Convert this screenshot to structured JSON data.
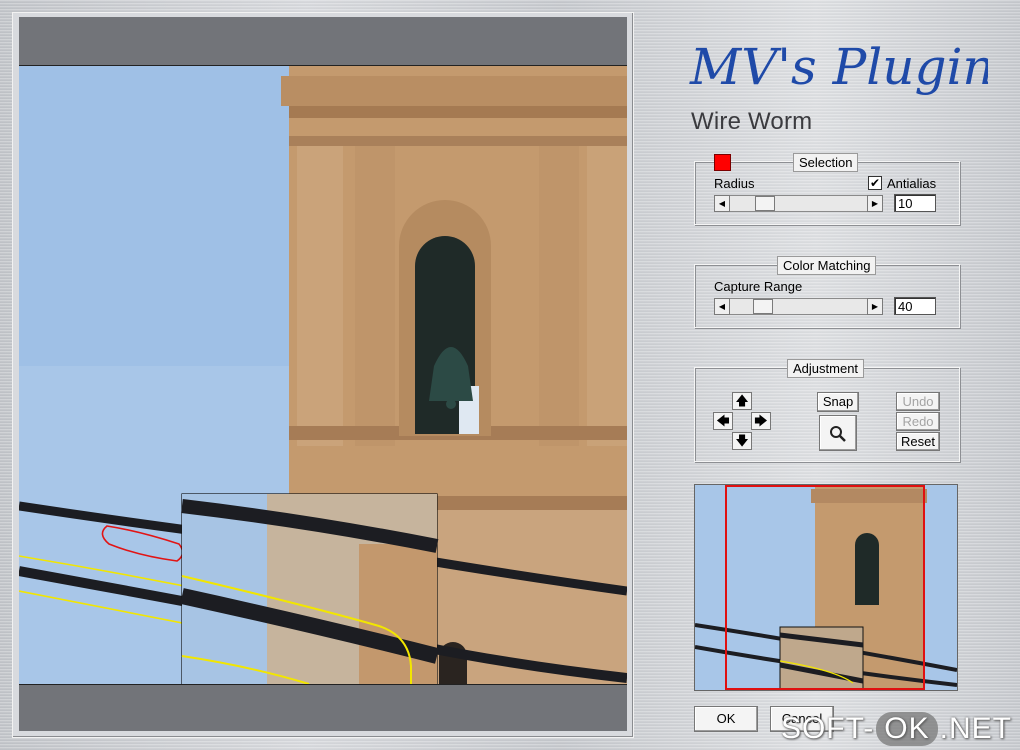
{
  "logo_text": "MV's Plugins",
  "plugin_title": "Wire Worm",
  "selection": {
    "group_title": "Selection",
    "color": "#ff0000",
    "radius_label": "Radius",
    "antialias_label": "Antialias",
    "antialias_checked": true,
    "radius_value": "10"
  },
  "color_matching": {
    "group_title": "Color Matching",
    "capture_label": "Capture Range",
    "capture_value": "40"
  },
  "adjustment": {
    "group_title": "Adjustment",
    "snap_label": "Snap",
    "undo_label": "Undo",
    "redo_label": "Redo",
    "reset_label": "Reset",
    "up": "🡅",
    "left": "🡄",
    "right": "🡆",
    "down": "🡇"
  },
  "buttons": {
    "ok_label": "OK",
    "cancel_label": "Cancel"
  },
  "watermark": {
    "pre": "SOFT-",
    "ok": "OK",
    "post": ".NET"
  },
  "colors": {
    "sky": "#a9c8ea",
    "brick": "#c79b6e",
    "selection_red": "#ff0000",
    "wire_yellow": "#f2e600",
    "logo_blue": "#1f4aa8"
  }
}
